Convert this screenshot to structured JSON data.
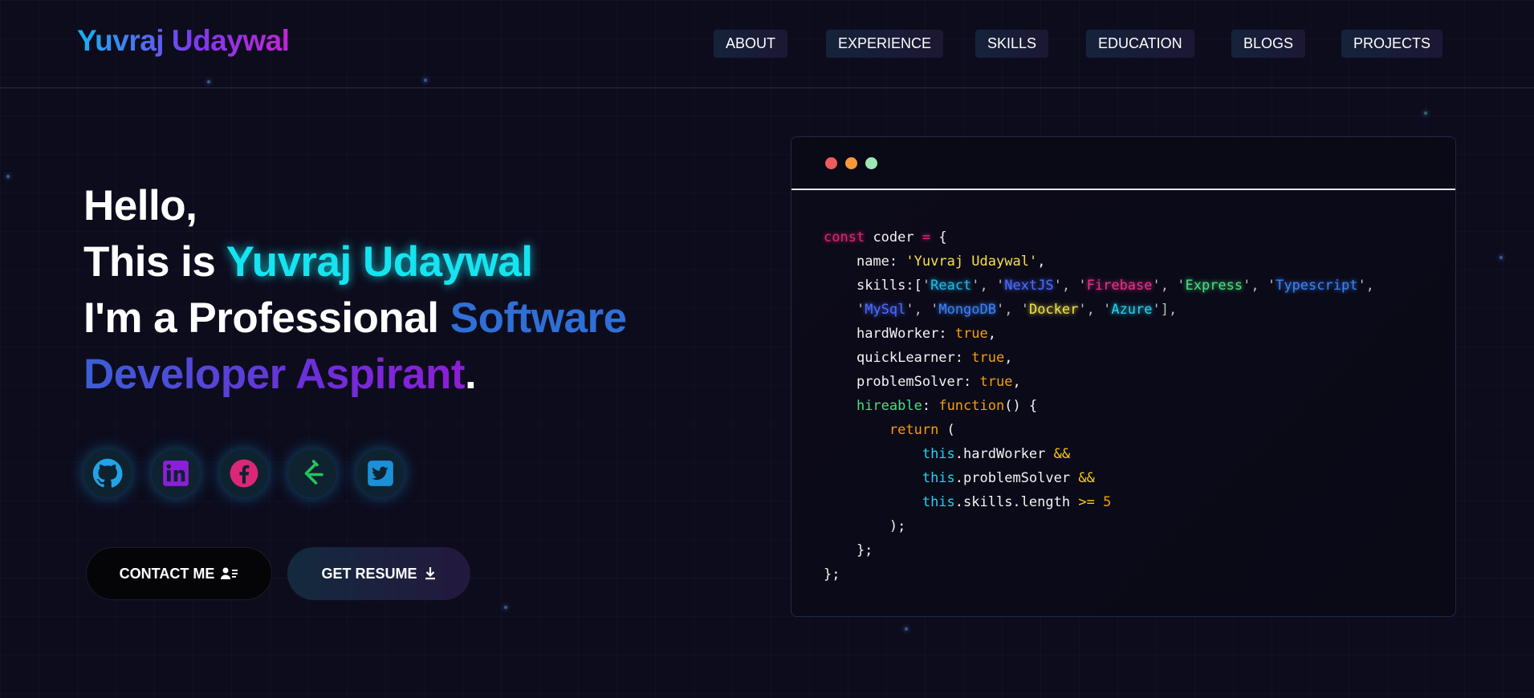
{
  "logo": "Yuvraj Udaywal",
  "nav": [
    "ABOUT",
    "EXPERIENCE",
    "SKILLS",
    "EDUCATION",
    "BLOGS",
    "PROJECTS"
  ],
  "hero": {
    "line1": "Hello,",
    "line2_prefix": "This is ",
    "line2_name": "Yuvraj Udaywal",
    "line3_prefix": "I'm a Professional ",
    "line3_word": "Software",
    "line4_word": "Developer Aspirant",
    "line4_suffix": "."
  },
  "socials": [
    {
      "icon": "github-icon"
    },
    {
      "icon": "linkedin-icon"
    },
    {
      "icon": "facebook-icon"
    },
    {
      "icon": "leetcode-icon"
    },
    {
      "icon": "twitter-icon"
    }
  ],
  "buttons": {
    "contact": "CONTACT ME",
    "resume": "GET RESUME"
  },
  "window_dots": [
    "#ef5b5b",
    "#f59a3a",
    "#9ee6b3"
  ],
  "code": {
    "const_kw": "const",
    "var_name": "coder",
    "name_key": "name",
    "name_val": "Yuvraj Udaywal",
    "skills_key": "skills",
    "skills": [
      "React",
      "NextJS",
      "Firebase",
      "Express",
      "Typescript",
      "MySql",
      "MongoDB",
      "Docker",
      "Azure"
    ],
    "hardworker_key": "hardWorker",
    "quicklearner_key": "quickLearner",
    "problemsolver_key": "problemSolver",
    "bool_true": "true",
    "hireable_key": "hireable",
    "function_kw": "function",
    "return_kw": "return",
    "this_kw": "this",
    "and_op": "&&",
    "length_expr": ".skills.length",
    "ge_op": ">=",
    "five": "5"
  }
}
